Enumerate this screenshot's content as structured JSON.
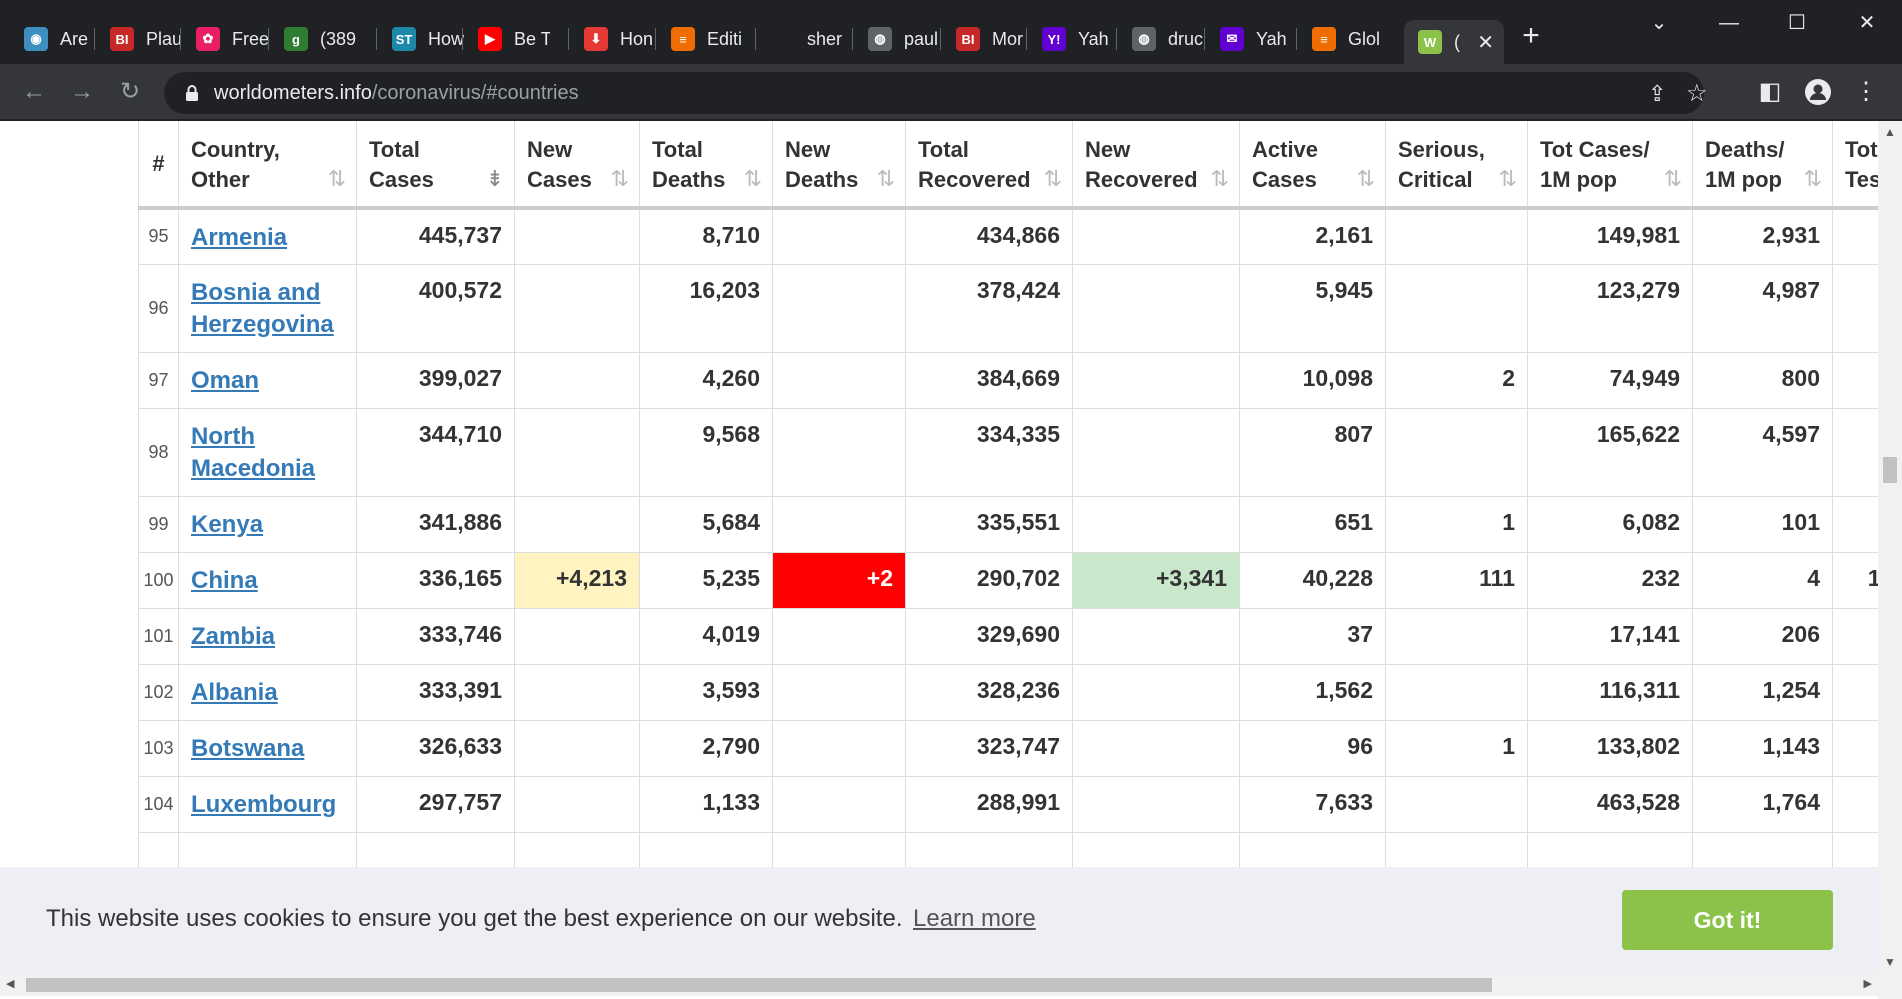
{
  "browser": {
    "tabs": [
      {
        "label": "Are",
        "icon": "globe-icon",
        "color": "#3c8fbf",
        "glyph": "◉"
      },
      {
        "label": "Plau",
        "icon": "business-insider-icon",
        "color": "#c62828",
        "glyph": "BI"
      },
      {
        "label": "Free",
        "icon": "flower-icon",
        "color": "#e91e63",
        "glyph": "✿"
      },
      {
        "label": "(389",
        "icon": "grammarly-g-icon",
        "color": "#2e7d32",
        "glyph": "g"
      },
      {
        "label": "How",
        "icon": "statista-icon",
        "color": "#1e88a8",
        "glyph": "ST"
      },
      {
        "label": "Be T",
        "icon": "youtube-icon",
        "color": "#ff0000",
        "glyph": "▶"
      },
      {
        "label": "Hon",
        "icon": "bookmark-red-icon",
        "color": "#e53935",
        "glyph": "⬇"
      },
      {
        "label": "Editi",
        "icon": "feed-orange-icon",
        "color": "#ef6c00",
        "glyph": "≡"
      },
      {
        "label": "sher",
        "icon": "blank-icon",
        "color": "#202124",
        "glyph": ""
      },
      {
        "label": "paul",
        "icon": "globe-grey-icon",
        "color": "#5f6368",
        "glyph": "◍"
      },
      {
        "label": "Mor",
        "icon": "business-insider-icon",
        "color": "#c62828",
        "glyph": "BI"
      },
      {
        "label": "Yah",
        "icon": "yahoo-icon",
        "color": "#6001d2",
        "glyph": "Y!"
      },
      {
        "label": "druc",
        "icon": "globe-grey-icon",
        "color": "#5f6368",
        "glyph": "◍"
      },
      {
        "label": "Yah",
        "icon": "yahoo-mail-icon",
        "color": "#6001d2",
        "glyph": "✉"
      },
      {
        "label": "Glol",
        "icon": "feed-orange-icon",
        "color": "#ef6c00",
        "glyph": "≡"
      },
      {
        "label": "(",
        "icon": "worldometer-icon",
        "color": "#8bc34a",
        "glyph": "W"
      }
    ],
    "new_tab_glyph": "+",
    "url_host": "worldometers.info",
    "url_path": "/coronavirus/#countries"
  },
  "table": {
    "headers": [
      {
        "label": "#"
      },
      {
        "line1": "Country,",
        "line2": "Other"
      },
      {
        "line1": "Total",
        "line2": "Cases"
      },
      {
        "line1": "New",
        "line2": "Cases"
      },
      {
        "line1": "Total",
        "line2": "Deaths"
      },
      {
        "line1": "New",
        "line2": "Deaths"
      },
      {
        "line1": "Total",
        "line2": "Recovered"
      },
      {
        "line1": "New",
        "line2": "Recovered"
      },
      {
        "line1": "Active",
        "line2": "Cases"
      },
      {
        "line1": "Serious,",
        "line2": "Critical"
      },
      {
        "line1": "Tot Cases/",
        "line2": "1M pop"
      },
      {
        "line1": "Deaths/",
        "line2": "1M pop"
      },
      {
        "line1": "Tot",
        "line2": "Tes"
      }
    ],
    "rows": [
      {
        "idx": "95",
        "country": "Armenia",
        "total_cases": "445,737",
        "new_cases": "",
        "total_deaths": "8,710",
        "new_deaths": "",
        "total_recovered": "434,866",
        "new_recovered": "",
        "active": "2,161",
        "serious": "",
        "cases_1m": "149,981",
        "deaths_1m": "2,931",
        "tests": ""
      },
      {
        "idx": "96",
        "country": "Bosnia and Herzegovina",
        "total_cases": "400,572",
        "new_cases": "",
        "total_deaths": "16,203",
        "new_deaths": "",
        "total_recovered": "378,424",
        "new_recovered": "",
        "active": "5,945",
        "serious": "",
        "cases_1m": "123,279",
        "deaths_1m": "4,987",
        "tests": ""
      },
      {
        "idx": "97",
        "country": "Oman",
        "total_cases": "399,027",
        "new_cases": "",
        "total_deaths": "4,260",
        "new_deaths": "",
        "total_recovered": "384,669",
        "new_recovered": "",
        "active": "10,098",
        "serious": "2",
        "cases_1m": "74,949",
        "deaths_1m": "800",
        "tests": ""
      },
      {
        "idx": "98",
        "country": "North Macedonia",
        "total_cases": "344,710",
        "new_cases": "",
        "total_deaths": "9,568",
        "new_deaths": "",
        "total_recovered": "334,335",
        "new_recovered": "",
        "active": "807",
        "serious": "",
        "cases_1m": "165,622",
        "deaths_1m": "4,597",
        "tests": ""
      },
      {
        "idx": "99",
        "country": "Kenya",
        "total_cases": "341,886",
        "new_cases": "",
        "total_deaths": "5,684",
        "new_deaths": "",
        "total_recovered": "335,551",
        "new_recovered": "",
        "active": "651",
        "serious": "1",
        "cases_1m": "6,082",
        "deaths_1m": "101",
        "tests": ""
      },
      {
        "idx": "100",
        "country": "China",
        "total_cases": "336,165",
        "new_cases": "+4,213",
        "total_deaths": "5,235",
        "new_deaths": "+2",
        "total_recovered": "290,702",
        "new_recovered": "+3,341",
        "active": "40,228",
        "serious": "111",
        "cases_1m": "232",
        "deaths_1m": "4",
        "tests": "1"
      },
      {
        "idx": "101",
        "country": "Zambia",
        "total_cases": "333,746",
        "new_cases": "",
        "total_deaths": "4,019",
        "new_deaths": "",
        "total_recovered": "329,690",
        "new_recovered": "",
        "active": "37",
        "serious": "",
        "cases_1m": "17,141",
        "deaths_1m": "206",
        "tests": ""
      },
      {
        "idx": "102",
        "country": "Albania",
        "total_cases": "333,391",
        "new_cases": "",
        "total_deaths": "3,593",
        "new_deaths": "",
        "total_recovered": "328,236",
        "new_recovered": "",
        "active": "1,562",
        "serious": "",
        "cases_1m": "116,311",
        "deaths_1m": "1,254",
        "tests": ""
      },
      {
        "idx": "103",
        "country": "Botswana",
        "total_cases": "326,633",
        "new_cases": "",
        "total_deaths": "2,790",
        "new_deaths": "",
        "total_recovered": "323,747",
        "new_recovered": "",
        "active": "96",
        "serious": "1",
        "cases_1m": "133,802",
        "deaths_1m": "1,143",
        "tests": ""
      },
      {
        "idx": "104",
        "country": "Luxembourg",
        "total_cases": "297,757",
        "new_cases": "",
        "total_deaths": "1,133",
        "new_deaths": "",
        "total_recovered": "288,991",
        "new_recovered": "",
        "active": "7,633",
        "serious": "",
        "cases_1m": "463,528",
        "deaths_1m": "1,764",
        "tests": ""
      }
    ]
  },
  "cookie_banner": {
    "text": "This website uses cookies to ensure you get the best experience on our website.",
    "learn_more": "Learn more",
    "button": "Got it!"
  },
  "colors": {
    "new_cases_highlight": "#fff3c2",
    "new_deaths_highlight": "#ff0000",
    "new_recovered_highlight": "#c9e7cb",
    "link": "#337ab7",
    "cookie_button": "#8bc34a"
  }
}
